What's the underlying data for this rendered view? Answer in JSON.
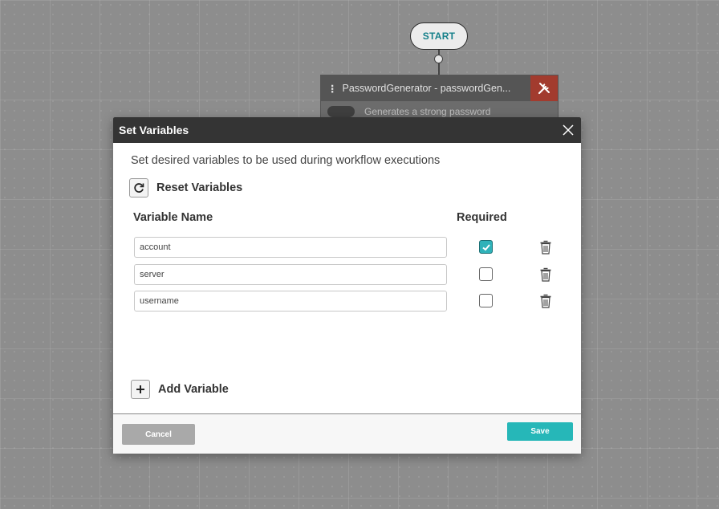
{
  "workflow": {
    "start_label": "START",
    "task": {
      "title": "PasswordGenerator - passwordGen...",
      "description": "Generates a strong password"
    }
  },
  "modal": {
    "title": "Set Variables",
    "description": "Set desired variables to be used during workflow executions",
    "reset_label": "Reset Variables",
    "columns": {
      "name": "Variable Name",
      "required": "Required"
    },
    "variables": [
      {
        "name": "account",
        "required": true
      },
      {
        "name": "server",
        "required": false
      },
      {
        "name": "username",
        "required": false
      }
    ],
    "add_label": "Add Variable",
    "cancel_label": "Cancel",
    "save_label": "Save"
  },
  "colors": {
    "accent": "#26b7b8",
    "header_bg": "#343434",
    "tool_red": "#a23b2e"
  },
  "icons": [
    "close-icon",
    "refresh-icon",
    "plus-icon",
    "trash-icon",
    "checkmark-icon",
    "tools-icon",
    "kebab-icon"
  ]
}
